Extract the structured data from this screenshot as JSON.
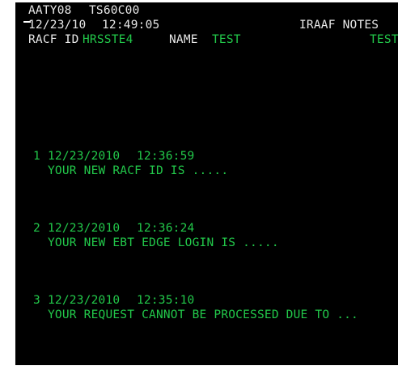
{
  "header": {
    "terminal_id": "AATY08",
    "transaction_id": "TS60C00",
    "date": "12/23/10",
    "time": "12:49:05",
    "screen_title": "IRAAF NOTES",
    "racf_label": "RACF ID",
    "racf_value": "HRSSTE4",
    "name_label": "NAME",
    "name_value": "TEST",
    "name_value_right": "TEST"
  },
  "notes": [
    {
      "number": "1",
      "date": "12/23/2010",
      "time": "12:36:59",
      "message": "YOUR NEW RACF ID IS ....."
    },
    {
      "number": "2",
      "date": "12/23/2010",
      "time": "12:36:24",
      "message": "YOUR NEW EBT EDGE LOGIN IS ....."
    },
    {
      "number": "3",
      "date": "12/23/2010",
      "time": "12:35:10",
      "message": "YOUR REQUEST CANNOT BE PROCESSED DUE TO ..."
    }
  ],
  "colors": {
    "background": "#000000",
    "label_text": "#e8e8e8",
    "value_text": "#22c84a"
  }
}
